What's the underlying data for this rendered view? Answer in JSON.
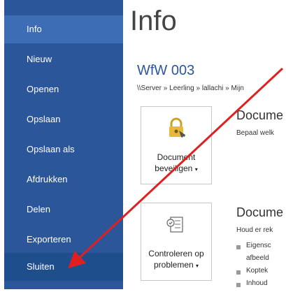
{
  "sidebar": {
    "items": [
      {
        "label": "Info"
      },
      {
        "label": "Nieuw"
      },
      {
        "label": "Openen"
      },
      {
        "label": "Opslaan"
      },
      {
        "label": "Opslaan als"
      },
      {
        "label": "Afdrukken"
      },
      {
        "label": "Delen"
      },
      {
        "label": "Exporteren"
      },
      {
        "label": "Sluiten"
      }
    ]
  },
  "main": {
    "title": "Info",
    "doc_name": "WfW 003",
    "path": "\\\\Server » Leerling » lallachi » Mijn",
    "protect": {
      "button_line1": "Document",
      "button_line2": "beveiligen",
      "section_title": "Docume",
      "section_desc": "Bepaal welk"
    },
    "inspect": {
      "button_line1": "Controleren op",
      "button_line2": "problemen",
      "section_title": "Docume",
      "section_desc": "Houd er rek",
      "bullets": [
        "Eigensc",
        "afbeeld",
        "Koptek",
        "Inhoud"
      ]
    }
  },
  "colors": {
    "sidebar": "#2b579a",
    "accent": "#2b579a",
    "arrow": "#e02020"
  }
}
